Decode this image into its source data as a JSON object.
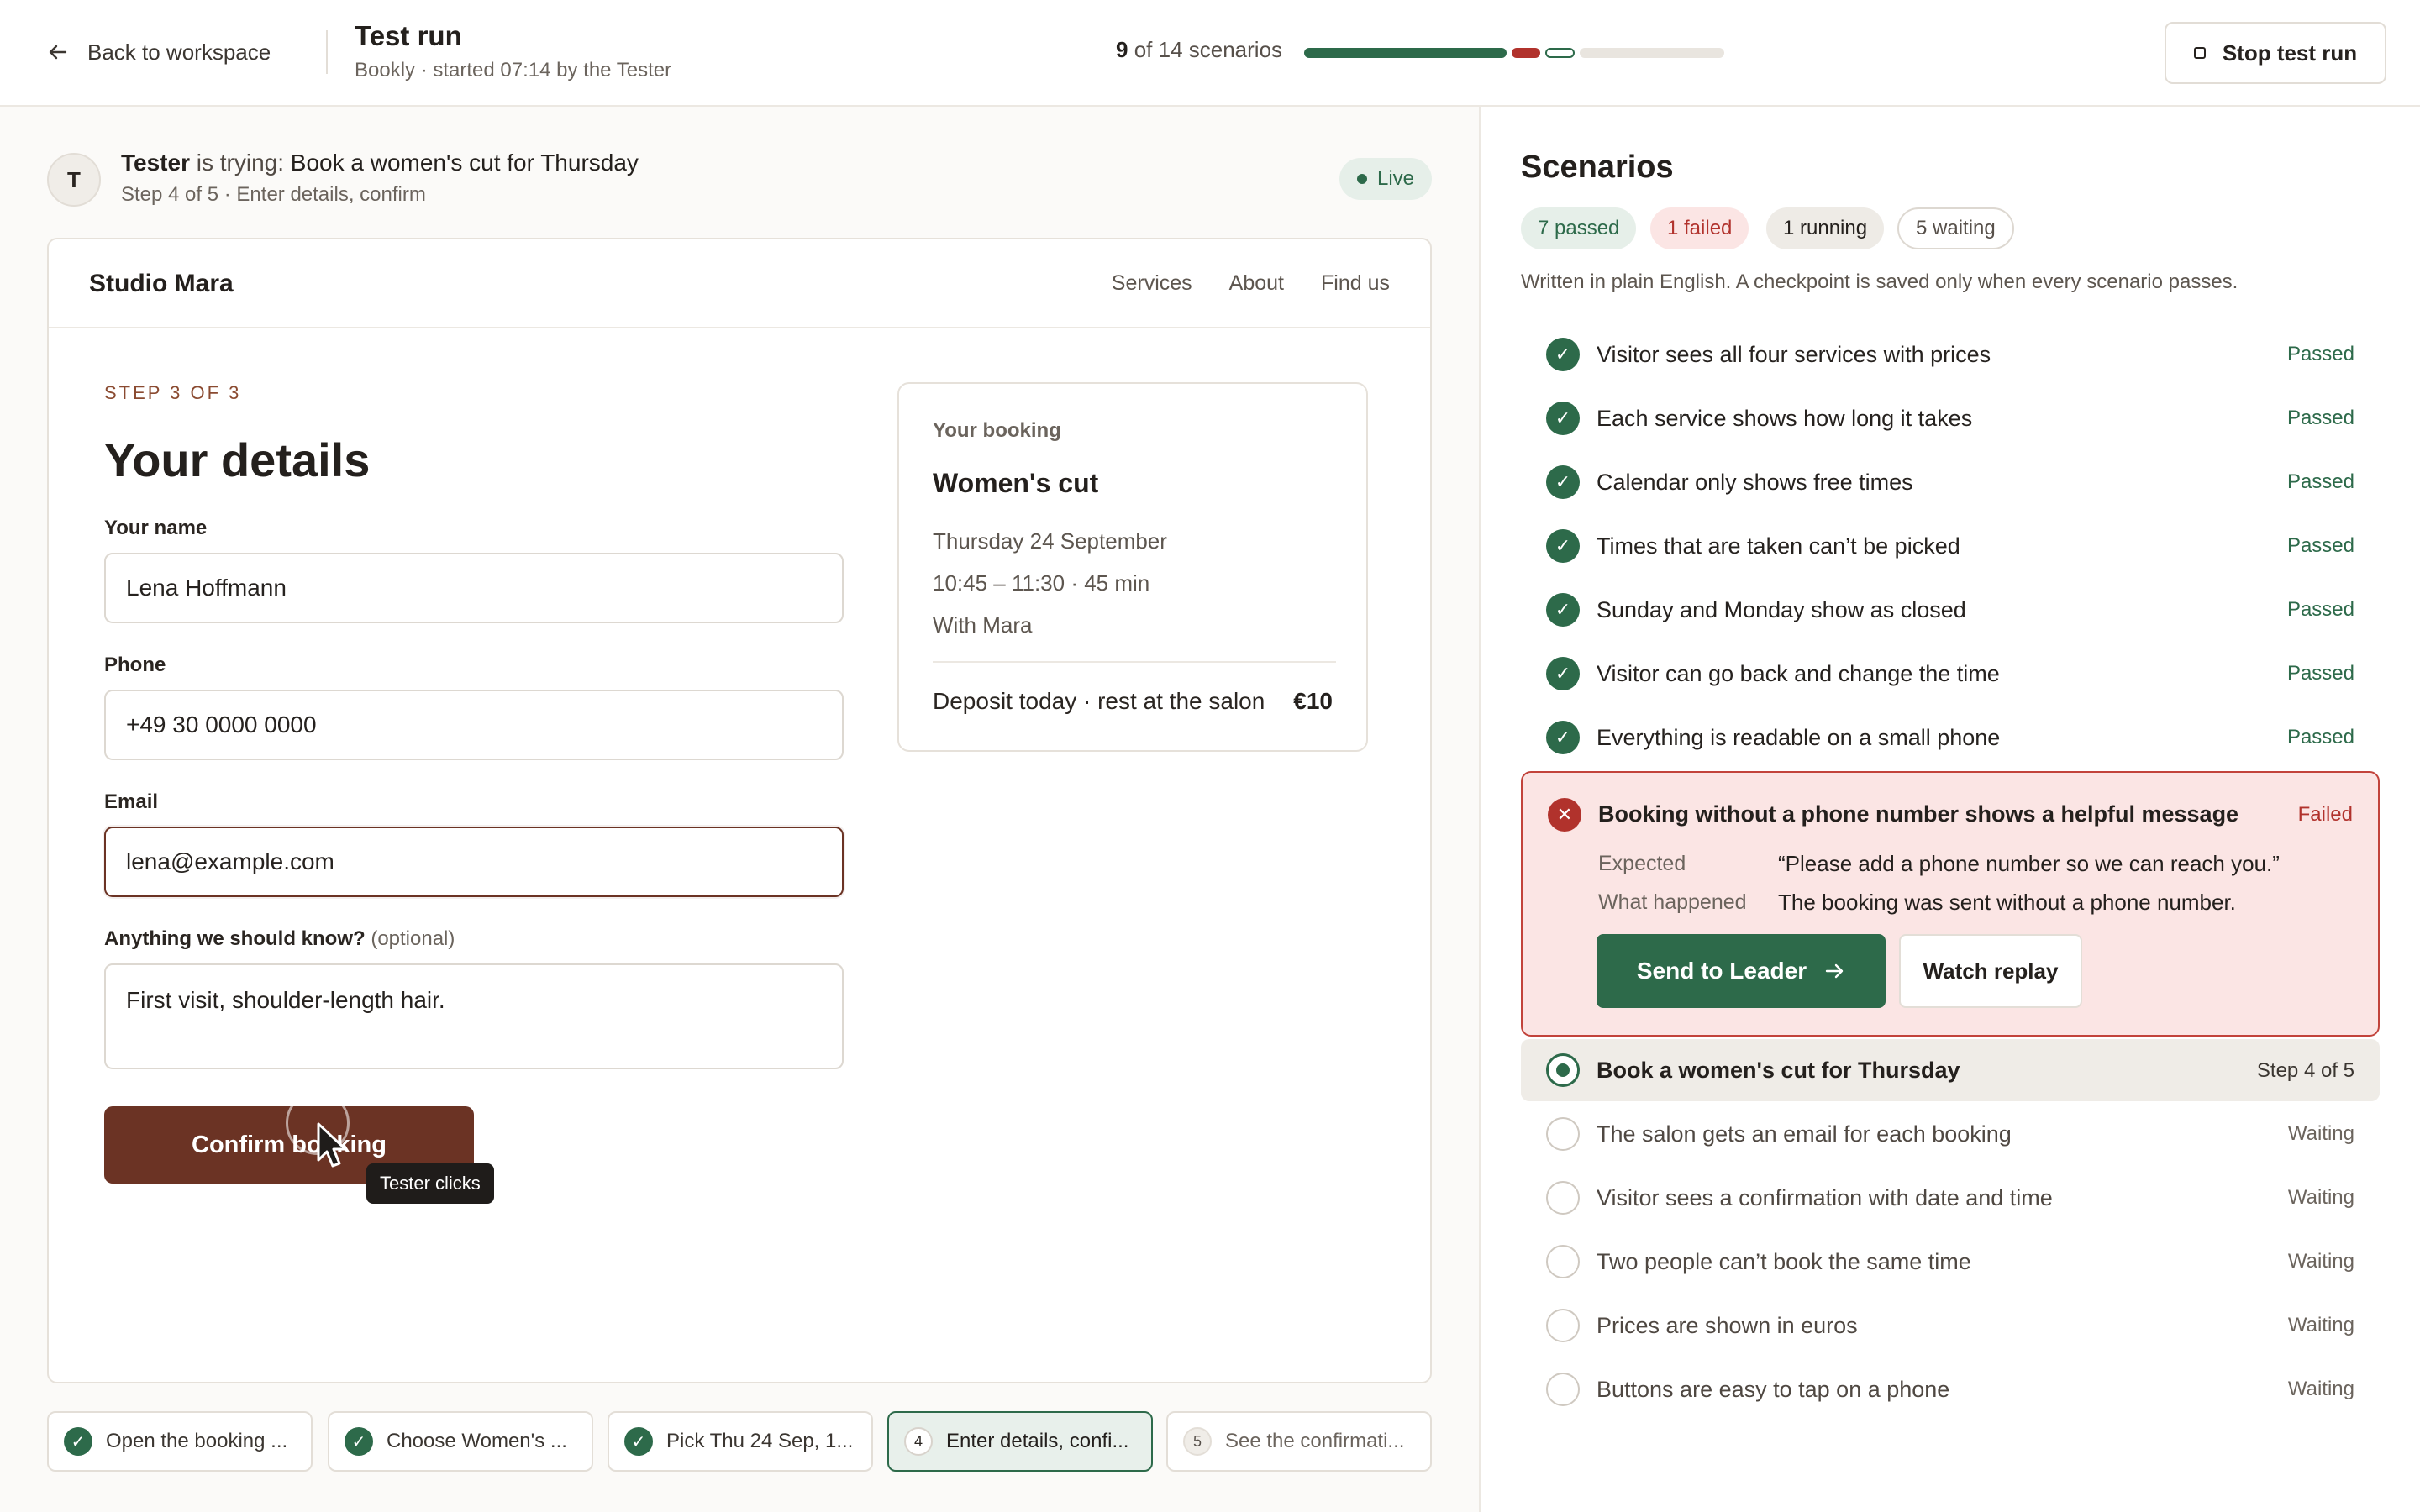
{
  "topbar": {
    "back_label": "Back to workspace",
    "title": "Test run",
    "subtitle": "Bookly · started 07:14 by the Tester",
    "scenario_done": "9",
    "scenario_total_text": "of 14 scenarios",
    "progress": {
      "passed": 7,
      "failed": 1,
      "running": 1,
      "waiting": 5,
      "total": 14
    },
    "stop_label": "Stop test run"
  },
  "session": {
    "avatar_initial": "T",
    "actor": "Tester",
    "verb": "is trying:",
    "task": "Book a women's cut for Thursday",
    "step_info": "Step 4 of 5 · Enter details, confirm",
    "live_label": "Live"
  },
  "site": {
    "name": "Studio Mara",
    "nav": [
      "Services",
      "About",
      "Find us"
    ],
    "step_label": "STEP 3 OF 3",
    "heading": "Your details",
    "fields": {
      "name_label": "Your name",
      "name_value": "Lena Hoffmann",
      "phone_label": "Phone",
      "phone_value": "+49 30 0000 0000",
      "email_label": "Email",
      "email_value": "lena@example.com",
      "notes_label": "Anything we should know?",
      "notes_optional": "(optional)",
      "notes_value": "First visit, shoulder-length hair."
    },
    "confirm_label": "Confirm booking",
    "tooltip": "Tester clicks",
    "booking": {
      "label": "Your booking",
      "service": "Women's cut",
      "date": "Thursday 24 September",
      "time": "10:45 – 11:30 · 45 min",
      "stylist": "With Mara",
      "deposit_text": "Deposit today · rest at the salon",
      "deposit_price": "€10"
    }
  },
  "steps": [
    {
      "marker": "✓",
      "label": "Open the booking ...",
      "state": "done"
    },
    {
      "marker": "✓",
      "label": "Choose Women's ...",
      "state": "done"
    },
    {
      "marker": "✓",
      "label": "Pick Thu 24 Sep, 1...",
      "state": "done"
    },
    {
      "marker": "4",
      "label": "Enter details, confi...",
      "state": "active"
    },
    {
      "marker": "5",
      "label": "See the confirmati...",
      "state": "todo"
    }
  ],
  "scenarios": {
    "title": "Scenarios",
    "counts": {
      "passed": "7 passed",
      "failed": "1 failed",
      "running": "1 running",
      "waiting": "5 waiting"
    },
    "note": "Written in plain English. A checkpoint is saved only when every scenario passes.",
    "passed_items": [
      {
        "text": "Visitor sees all four services with prices",
        "status": "Passed"
      },
      {
        "text": "Each service shows how long it takes",
        "status": "Passed"
      },
      {
        "text": "Calendar only shows free times",
        "status": "Passed"
      },
      {
        "text": "Times that are taken can’t be picked",
        "status": "Passed"
      },
      {
        "text": "Sunday and Monday show as closed",
        "status": "Passed"
      },
      {
        "text": "Visitor can go back and change the time",
        "status": "Passed"
      },
      {
        "text": "Everything is readable on a small phone",
        "status": "Passed"
      }
    ],
    "failed_item": {
      "text": "Booking without a phone number shows a helpful message",
      "status": "Failed",
      "expected_label": "Expected",
      "expected_value": "“Please add a phone number so we can reach you.”",
      "happened_label": "What happened",
      "happened_value": "The booking was sent without a phone number.",
      "send_label": "Send to Leader",
      "replay_label": "Watch replay"
    },
    "running_item": {
      "text": "Book a women's cut for Thursday",
      "status": "Step 4 of 5"
    },
    "waiting_items": [
      {
        "text": "The salon gets an email for each booking",
        "status": "Waiting"
      },
      {
        "text": "Visitor sees a confirmation with date and time",
        "status": "Waiting"
      },
      {
        "text": "Two people can’t book the same time",
        "status": "Waiting"
      },
      {
        "text": "Prices are shown in euros",
        "status": "Waiting"
      },
      {
        "text": "Buttons are easy to tap on a phone",
        "status": "Waiting"
      }
    ]
  },
  "colors": {
    "accent_green": "#2d6a4a",
    "fail_red": "#b1322c",
    "brand_brown": "#6b3324"
  }
}
